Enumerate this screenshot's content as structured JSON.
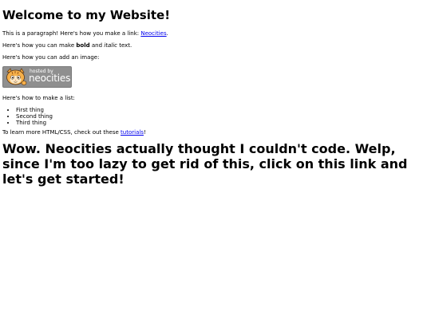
{
  "heading": "Welcome to my Website!",
  "para1": {
    "before": "This is a paragraph! Here's how you make a link: ",
    "link": "Neocities",
    "after": "."
  },
  "para2": {
    "before": "Here's how you can make ",
    "bold": "bold",
    "middle": " and ",
    "italic": "italic",
    "after": " text."
  },
  "para3": "Here's how you can add an image:",
  "badge": {
    "hosted": "hosted by",
    "brand": "neocities",
    "icon": "cat-mascot-icon"
  },
  "para4": "Here's how to make a list:",
  "list": [
    "First thing",
    "Second thing",
    "Third thing"
  ],
  "para5": {
    "before": "To learn more HTML/CSS, check out these ",
    "link": "tutorials",
    "after": "!"
  },
  "big_heading": "Wow. Neocities actually thought I couldn't code. Welp, since I'm too lazy to get rid of this, click on this link and let's get started!",
  "colors": {
    "link": "#0000ee",
    "badge_bg": "#8f8f8f",
    "text": "#000000"
  }
}
